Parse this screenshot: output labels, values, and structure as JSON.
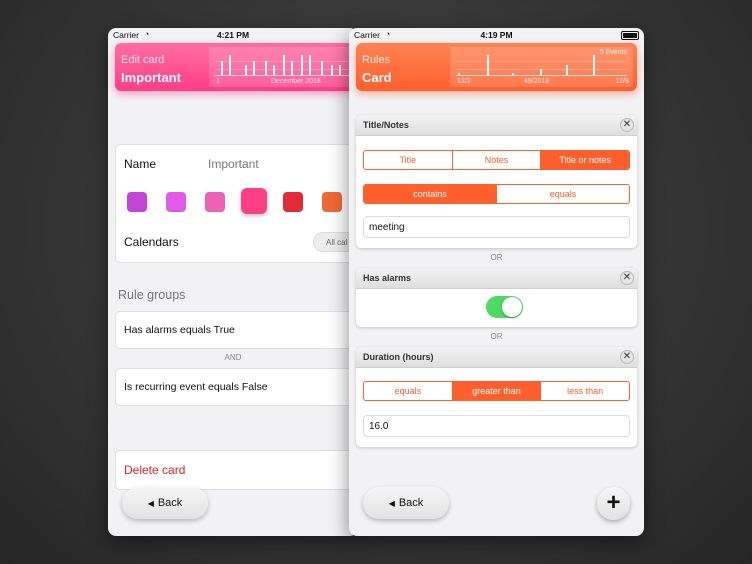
{
  "left": {
    "status": {
      "carrier": "Carrier",
      "time": "4:21 PM"
    },
    "header": {
      "subtitle": "Edit card",
      "title": "Important",
      "axis_start": "1",
      "axis_month": "December 2018"
    },
    "name_label": "Name",
    "name_value": "Important",
    "colors": [
      "#c444d8",
      "#e35ae6",
      "#f060b5",
      "#ff3f84",
      "#e02a35",
      "#f06a35"
    ],
    "selected_color_index": 3,
    "calendars_label": "Calendars",
    "calendars_button": "All cal",
    "rule_groups_title": "Rule groups",
    "rule_groups": [
      "Has alarms equals True",
      "Is recurring event equals False"
    ],
    "and_label": "AND",
    "delete_label": "Delete card",
    "back_label": "Back"
  },
  "right": {
    "status": {
      "carrier": "Carrier",
      "time": "4:19 PM"
    },
    "header": {
      "subtitle": "Rules",
      "title": "Card",
      "events": "5 Events",
      "axis_start": "12/2",
      "axis_mid": "49/2018",
      "axis_end": "12/8"
    },
    "panels": {
      "title_notes": {
        "title": "Title/Notes",
        "fields": [
          "Title",
          "Notes",
          "Title or notes"
        ],
        "field_selected": 2,
        "matches": [
          "contains",
          "equals"
        ],
        "match_selected": 0,
        "value": "meeting"
      },
      "has_alarms": {
        "title": "Has alarms",
        "on": true
      },
      "duration": {
        "title": "Duration (hours)",
        "ops": [
          "equals",
          "greater than",
          "less than"
        ],
        "op_selected": 1,
        "value": "16.0"
      }
    },
    "or_label": "OR",
    "close_glyph": "✕",
    "back_label": "Back",
    "add_glyph": "+"
  }
}
